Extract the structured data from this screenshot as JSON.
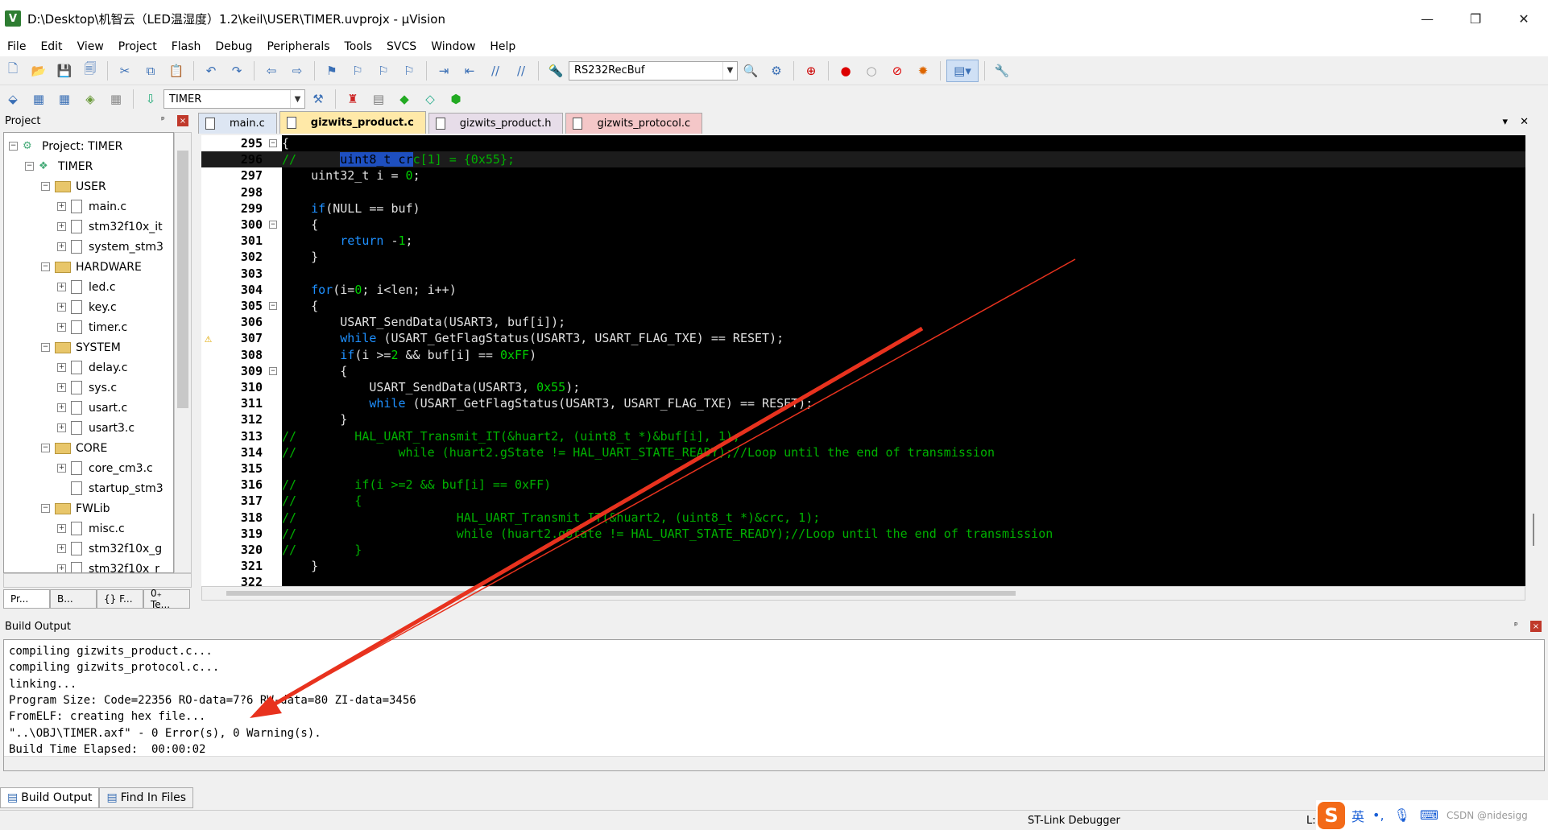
{
  "window": {
    "title": "D:\\Desktop\\机智云（LED温湿度）1.2\\keil\\USER\\TIMER.uvprojx - µVision",
    "icon_letter": "V",
    "min": "—",
    "restore": "❐",
    "close": "✕"
  },
  "menu": [
    "File",
    "Edit",
    "View",
    "Project",
    "Flash",
    "Debug",
    "Peripherals",
    "Tools",
    "SVCS",
    "Window",
    "Help"
  ],
  "toolbar1": {
    "combo_value": "RS232RecBuf"
  },
  "toolbar2": {
    "target_value": "TIMER"
  },
  "project_panel": {
    "header": "Project",
    "pin": "ᵖ",
    "close": "×",
    "items": [
      {
        "label": "Project: TIMER",
        "level": 0,
        "kind": "project",
        "expander": "−"
      },
      {
        "label": "TIMER",
        "level": 1,
        "kind": "target",
        "expander": "−"
      },
      {
        "label": "USER",
        "level": 2,
        "kind": "folder",
        "expander": "−"
      },
      {
        "label": "main.c",
        "level": 3,
        "kind": "file",
        "expander": "+"
      },
      {
        "label": "stm32f10x_it",
        "level": 3,
        "kind": "file",
        "expander": "+"
      },
      {
        "label": "system_stm3",
        "level": 3,
        "kind": "file",
        "expander": "+"
      },
      {
        "label": "HARDWARE",
        "level": 2,
        "kind": "folder",
        "expander": "−"
      },
      {
        "label": "led.c",
        "level": 3,
        "kind": "file",
        "expander": "+"
      },
      {
        "label": "key.c",
        "level": 3,
        "kind": "file",
        "expander": "+"
      },
      {
        "label": "timer.c",
        "level": 3,
        "kind": "file",
        "expander": "+"
      },
      {
        "label": "SYSTEM",
        "level": 2,
        "kind": "folder",
        "expander": "−"
      },
      {
        "label": "delay.c",
        "level": 3,
        "kind": "file",
        "expander": "+"
      },
      {
        "label": "sys.c",
        "level": 3,
        "kind": "file",
        "expander": "+"
      },
      {
        "label": "usart.c",
        "level": 3,
        "kind": "file",
        "expander": "+"
      },
      {
        "label": "usart3.c",
        "level": 3,
        "kind": "file",
        "expander": "+"
      },
      {
        "label": "CORE",
        "level": 2,
        "kind": "folder",
        "expander": "−"
      },
      {
        "label": "core_cm3.c",
        "level": 3,
        "kind": "file",
        "expander": "+"
      },
      {
        "label": "startup_stm3",
        "level": 3,
        "kind": "file",
        "expander": ""
      },
      {
        "label": "FWLib",
        "level": 2,
        "kind": "folder",
        "expander": "−"
      },
      {
        "label": "misc.c",
        "level": 3,
        "kind": "file",
        "expander": "+"
      },
      {
        "label": "stm32f10x_g",
        "level": 3,
        "kind": "file",
        "expander": "+"
      },
      {
        "label": "stm32f10x_r",
        "level": 3,
        "kind": "file",
        "expander": "+"
      }
    ],
    "bottom_tabs": [
      "Pr...",
      "B...",
      "{} F...",
      "0₊ Te..."
    ]
  },
  "editor": {
    "tabs": [
      {
        "label": "main.c",
        "bg": "#dde6f3",
        "active": false
      },
      {
        "label": "gizwits_product.c",
        "bg": "#ffe9a8",
        "active": true
      },
      {
        "label": "gizwits_product.h",
        "bg": "#e7dde9",
        "active": false
      },
      {
        "label": "gizwits_protocol.c",
        "bg": "#f4c7c8",
        "active": false
      }
    ],
    "tab_menu": "▾",
    "tab_close": "✕",
    "warning_line": "307",
    "lines": [
      {
        "n": "295",
        "fold": "−",
        "segs": [
          {
            "t": "{",
            "c": ""
          }
        ]
      },
      {
        "n": "296",
        "fold": "",
        "current": true,
        "segs": [
          {
            "t": "//      ",
            "c": "cmt"
          },
          {
            "t": "uint8_t cr",
            "c": "hl"
          },
          {
            "t": "c[1] = {0x55};",
            "c": "cmt"
          }
        ]
      },
      {
        "n": "297",
        "fold": "",
        "segs": [
          {
            "t": "    uint32_t i = ",
            "c": ""
          },
          {
            "t": "0",
            "c": "num"
          },
          {
            "t": ";",
            "c": ""
          }
        ]
      },
      {
        "n": "298",
        "fold": "",
        "segs": []
      },
      {
        "n": "299",
        "fold": "",
        "segs": [
          {
            "t": "    ",
            "c": ""
          },
          {
            "t": "if",
            "c": "kw"
          },
          {
            "t": "(NULL == buf)",
            "c": ""
          }
        ]
      },
      {
        "n": "300",
        "fold": "−",
        "segs": [
          {
            "t": "    {",
            "c": ""
          }
        ]
      },
      {
        "n": "301",
        "fold": "",
        "segs": [
          {
            "t": "        ",
            "c": ""
          },
          {
            "t": "return",
            "c": "kw"
          },
          {
            "t": " -",
            "c": ""
          },
          {
            "t": "1",
            "c": "num"
          },
          {
            "t": ";",
            "c": ""
          }
        ]
      },
      {
        "n": "302",
        "fold": "",
        "segs": [
          {
            "t": "    }",
            "c": ""
          }
        ]
      },
      {
        "n": "303",
        "fold": "",
        "segs": []
      },
      {
        "n": "304",
        "fold": "",
        "segs": [
          {
            "t": "    ",
            "c": ""
          },
          {
            "t": "for",
            "c": "kw"
          },
          {
            "t": "(i=",
            "c": ""
          },
          {
            "t": "0",
            "c": "num"
          },
          {
            "t": "; i<len; i++)",
            "c": ""
          }
        ]
      },
      {
        "n": "305",
        "fold": "−",
        "segs": [
          {
            "t": "    {",
            "c": ""
          }
        ]
      },
      {
        "n": "306",
        "fold": "",
        "segs": [
          {
            "t": "        USART_SendData(USART3, buf[i]);",
            "c": ""
          }
        ]
      },
      {
        "n": "307",
        "fold": "",
        "segs": [
          {
            "t": "        ",
            "c": ""
          },
          {
            "t": "while",
            "c": "kw"
          },
          {
            "t": " (USART_GetFlagStatus(USART3, USART_FLAG_TXE) == RESET);",
            "c": ""
          }
        ]
      },
      {
        "n": "308",
        "fold": "",
        "segs": [
          {
            "t": "        ",
            "c": ""
          },
          {
            "t": "if",
            "c": "kw"
          },
          {
            "t": "(i >=",
            "c": ""
          },
          {
            "t": "2",
            "c": "num"
          },
          {
            "t": " && buf[i] == ",
            "c": ""
          },
          {
            "t": "0xFF",
            "c": "num"
          },
          {
            "t": ")",
            "c": ""
          }
        ]
      },
      {
        "n": "309",
        "fold": "−",
        "segs": [
          {
            "t": "        {",
            "c": ""
          }
        ]
      },
      {
        "n": "310",
        "fold": "",
        "segs": [
          {
            "t": "            USART_SendData(USART3, ",
            "c": ""
          },
          {
            "t": "0x55",
            "c": "num"
          },
          {
            "t": ");",
            "c": ""
          }
        ]
      },
      {
        "n": "311",
        "fold": "",
        "segs": [
          {
            "t": "            ",
            "c": ""
          },
          {
            "t": "while",
            "c": "kw"
          },
          {
            "t": " (USART_GetFlagStatus(USART3, USART_FLAG_TXE) == RESET);",
            "c": ""
          }
        ]
      },
      {
        "n": "312",
        "fold": "",
        "segs": [
          {
            "t": "        }",
            "c": ""
          }
        ]
      },
      {
        "n": "313",
        "fold": "",
        "segs": [
          {
            "t": "//        HAL_UART_Transmit_IT(&huart2, (uint8_t *)&buf[i], 1);",
            "c": "cmt"
          }
        ]
      },
      {
        "n": "314",
        "fold": "",
        "segs": [
          {
            "t": "//              while (huart2.gState != HAL_UART_STATE_READY);//Loop until the end of transmission",
            "c": "cmt"
          }
        ]
      },
      {
        "n": "315",
        "fold": "",
        "segs": []
      },
      {
        "n": "316",
        "fold": "",
        "segs": [
          {
            "t": "//        if(i >=2 && buf[i] == 0xFF)",
            "c": "cmt"
          }
        ]
      },
      {
        "n": "317",
        "fold": "",
        "segs": [
          {
            "t": "//        {",
            "c": "cmt"
          }
        ]
      },
      {
        "n": "318",
        "fold": "",
        "segs": [
          {
            "t": "//                      HAL_UART_Transmit_IT(&huart2, (uint8_t *)&crc, 1);",
            "c": "cmt"
          }
        ]
      },
      {
        "n": "319",
        "fold": "",
        "segs": [
          {
            "t": "//                      while (huart2.gState != HAL_UART_STATE_READY);//Loop until the end of transmission",
            "c": "cmt"
          }
        ]
      },
      {
        "n": "320",
        "fold": "",
        "segs": [
          {
            "t": "//        }",
            "c": "cmt"
          }
        ]
      },
      {
        "n": "321",
        "fold": "",
        "segs": [
          {
            "t": "    }",
            "c": ""
          }
        ]
      },
      {
        "n": "322",
        "fold": "",
        "segs": []
      }
    ]
  },
  "build_output": {
    "header": "Build Output",
    "pin": "ᵖ",
    "close": "×",
    "lines": [
      "compiling gizwits_product.c...",
      "compiling gizwits_protocol.c...",
      "linking...",
      "Program Size: Code=22356 RO-data=7?6 RW-data=80 ZI-data=3456",
      "FromELF: creating hex file...",
      "\"..\\OBJ\\TIMER.axf\" - 0 Error(s), 0 Warning(s).",
      "Build Time Elapsed:  00:00:02"
    ],
    "tabs": [
      "Build Output",
      "Find In Files"
    ]
  },
  "status": {
    "debugger": "ST-Link Debugger",
    "pos": "L:2",
    "ime": "英",
    "ime_logo": "S",
    "tray": "CSDN @nidesigg"
  },
  "annotation": {
    "arrow_color": "#e8321e"
  }
}
